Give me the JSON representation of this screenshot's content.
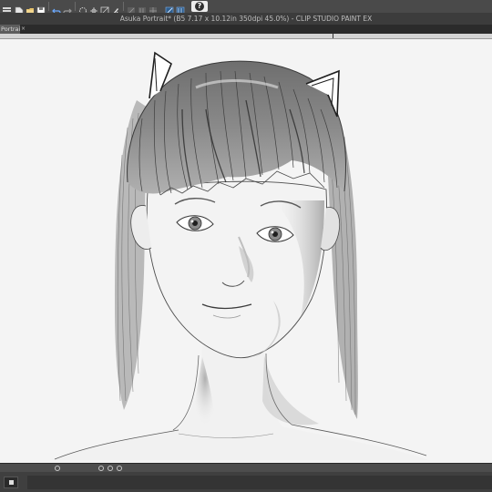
{
  "window": {
    "title": "Asuka Portrait* (B5 7.17 x 10.12in 350dpi 45.0%)  - CLIP STUDIO PAINT EX"
  },
  "tab": {
    "label": "Portrait*",
    "close_glyph": "×"
  },
  "toolbar": {
    "icons": [
      "menu-icon",
      "new-file-icon",
      "open-file-icon",
      "save-icon",
      "undo-icon",
      "redo-icon",
      "transform-icon",
      "grid-icon",
      "ruler-icon",
      "pen-icon",
      "snap-icon",
      "snap-ruler-icon",
      "snap-grid-icon",
      "help-icon"
    ],
    "help_label": "?"
  },
  "canvas": {
    "background": "#f4f4f4",
    "artwork": "pencil portrait sketch"
  },
  "statusbar": {
    "icons": [
      "navigator-icon",
      "zoom-icon",
      "rotate-icon",
      "flip-icon"
    ]
  },
  "layers": {
    "thumb_icon": "layer-thumbnail-icon"
  }
}
